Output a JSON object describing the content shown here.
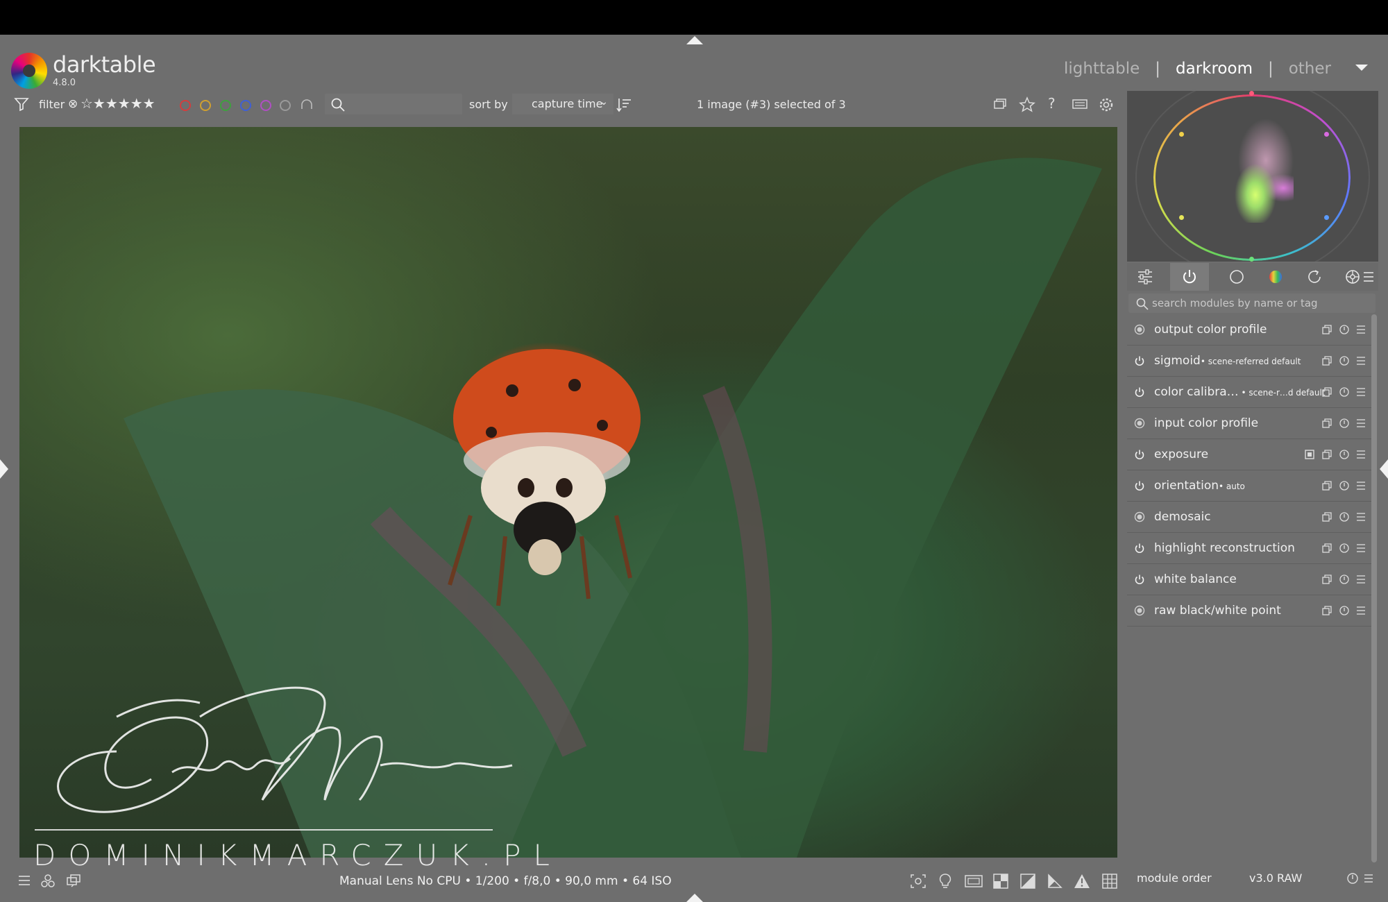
{
  "app": {
    "name": "darktable",
    "version": "4.8.0"
  },
  "views": {
    "lighttable": "lighttable",
    "darkroom": "darkroom",
    "other": "other",
    "separator": "|"
  },
  "filterbar": {
    "filter_label": "filter",
    "reject_glyph": "⊗",
    "stars": "☆★★★★★",
    "color_labels": [
      "#d43d3d",
      "#d0a030",
      "#3fa13f",
      "#3f5fd6",
      "#b04fc4",
      "#9a9a9a"
    ],
    "sort_label": "sort by",
    "sort_value": "capture time",
    "sort_chevron": "⌄",
    "selection_count": "1 image (#3) selected of 3"
  },
  "image": {
    "watermark": "DOMINIKMARCZUK.PL",
    "icons": [
      "ladybug-photo",
      "signature-watermark"
    ]
  },
  "bottombar": {
    "exif": "Manual Lens No CPU • 1/200 • f/8,0 • 90,0 mm • 64 ISO"
  },
  "right_panel": {
    "module_search_placeholder": "search modules by name or tag",
    "modules": [
      {
        "name": "output color profile",
        "tag": "",
        "state": "always-on"
      },
      {
        "name": "sigmoid",
        "tag": "• scene-referred default",
        "state": "on"
      },
      {
        "name": "color calibra…",
        "tag": " • scene-r…d default",
        "state": "on"
      },
      {
        "name": "input color profile",
        "tag": "",
        "state": "always-on"
      },
      {
        "name": "exposure",
        "tag": "",
        "state": "on",
        "mask": true
      },
      {
        "name": "orientation",
        "tag": "• auto",
        "state": "on"
      },
      {
        "name": "demosaic",
        "tag": "",
        "state": "always-on"
      },
      {
        "name": "highlight reconstruction",
        "tag": "",
        "state": "on"
      },
      {
        "name": "white balance",
        "tag": "",
        "state": "on"
      },
      {
        "name": "raw black/white point",
        "tag": "",
        "state": "always-on"
      }
    ],
    "module_order_label": "module order",
    "module_order_value": "v3.0 RAW"
  },
  "colors": {
    "panel_bg": "#6e6e6e",
    "top_bar": "#000000",
    "text": "#e6e6e6",
    "active_view": "#ffffff"
  }
}
